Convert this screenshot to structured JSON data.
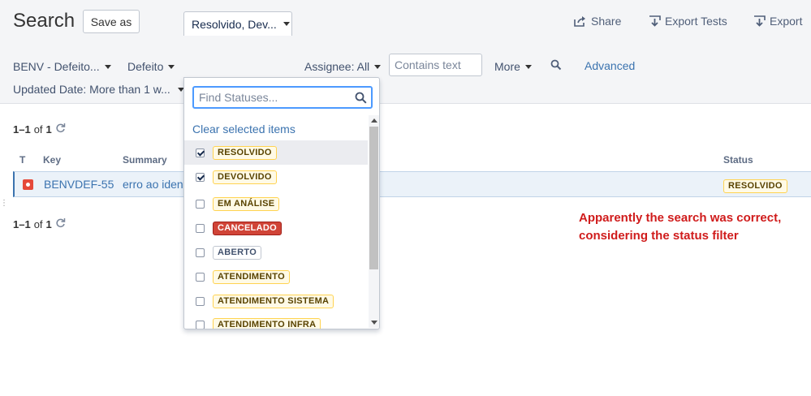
{
  "header": {
    "title": "Search",
    "save_as": "Save as",
    "share": "Share",
    "export_tests": "Export Tests",
    "export": "Export"
  },
  "filters": {
    "project": "BENV - Defeito...",
    "type": "Defeito",
    "status": "Resolvido, Dev...",
    "assignee": "Assignee: All",
    "contains_text_placeholder": "Contains text",
    "more": "More",
    "advanced": "Advanced",
    "updated_date": "Updated Date: More than 1 w..."
  },
  "results": {
    "count_range": "1–1",
    "count_of": "of",
    "count_total": "1",
    "columns": [
      "T",
      "Key",
      "Summary",
      "Status"
    ],
    "rows": [
      {
        "key": "BENVDEF-55",
        "summary": "erro ao ident",
        "status": "RESOLVIDO"
      }
    ]
  },
  "status_dropdown": {
    "search_placeholder": "Find Statuses...",
    "clear_label": "Clear selected items",
    "options": [
      {
        "label": "RESOLVIDO",
        "checked": true,
        "color": "yellow"
      },
      {
        "label": "DEVOLVIDO",
        "checked": true,
        "color": "yellow"
      },
      {
        "label": "EM ANÁLISE",
        "checked": false,
        "color": "yellow"
      },
      {
        "label": "CANCELADO",
        "checked": false,
        "color": "red"
      },
      {
        "label": "ABERTO",
        "checked": false,
        "color": "blue-gray"
      },
      {
        "label": "ATENDIMENTO",
        "checked": false,
        "color": "yellow"
      },
      {
        "label": "ATENDIMENTO SISTEMA",
        "checked": false,
        "color": "yellow"
      },
      {
        "label": "ATENDIMENTO INFRA",
        "checked": false,
        "color": "yellow"
      }
    ]
  },
  "annotation": {
    "line1": "Apparently the search was correct,",
    "line2": "considering the status filter"
  },
  "colors": {
    "link": "#3b73af",
    "annotation": "#d01c1c",
    "focus": "#4c9aff",
    "bug_icon": "#e5493a"
  },
  "icons": {
    "share": "share-icon",
    "export_tests": "export-tests-icon",
    "export": "export-icon",
    "search": "search-icon",
    "refresh": "refresh-icon",
    "bug": "bug-type-icon"
  }
}
